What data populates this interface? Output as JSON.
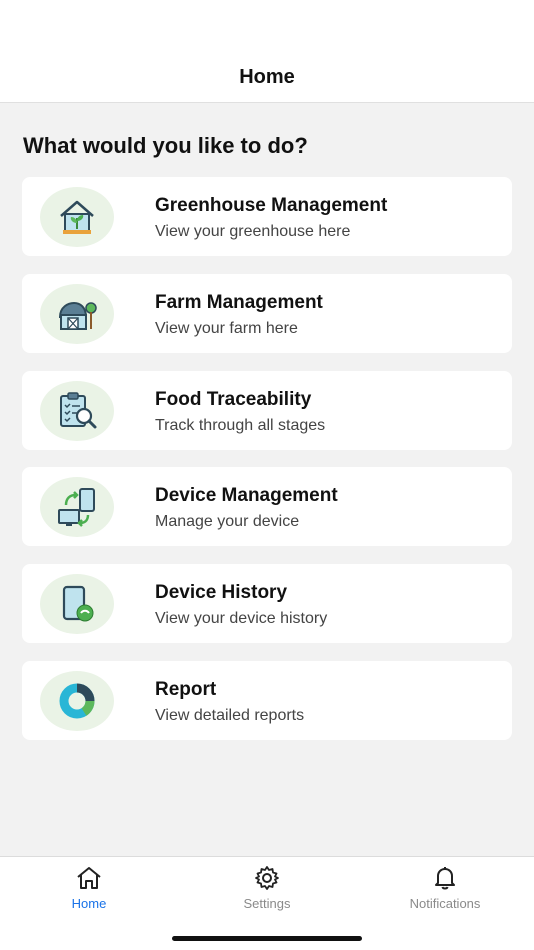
{
  "header": {
    "title": "Home"
  },
  "prompt": "What would you like to do?",
  "cards": [
    {
      "title": "Greenhouse Management",
      "subtitle": "View your greenhouse here",
      "icon": "greenhouse-icon"
    },
    {
      "title": "Farm Management",
      "subtitle": "View your farm here",
      "icon": "barn-icon"
    },
    {
      "title": "Food Traceability",
      "subtitle": "Track through all stages",
      "icon": "clipboard-search-icon"
    },
    {
      "title": "Device Management",
      "subtitle": "Manage your device",
      "icon": "device-sync-icon"
    },
    {
      "title": "Device History",
      "subtitle": "View your device history",
      "icon": "tablet-history-icon"
    },
    {
      "title": "Report",
      "subtitle": "View detailed reports",
      "icon": "donut-chart-icon"
    }
  ],
  "tabbar": {
    "items": [
      {
        "label": "Home",
        "icon": "home-icon",
        "active": true
      },
      {
        "label": "Settings",
        "icon": "gear-icon",
        "active": false
      },
      {
        "label": "Notifications",
        "icon": "bell-icon",
        "active": false
      }
    ]
  },
  "colors": {
    "accent": "#1a73e8",
    "icon_bg": "#eaf3e6",
    "page_bg": "#f2f2f2"
  }
}
